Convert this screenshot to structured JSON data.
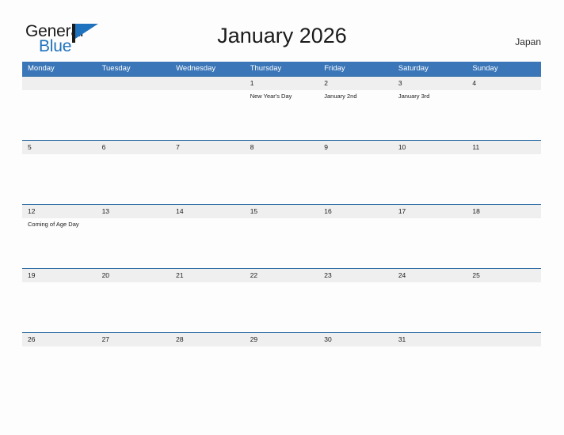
{
  "brand": {
    "name_part1": "General",
    "name_part2": "Blue",
    "mark": "flag-triangle"
  },
  "header": {
    "title": "January 2026",
    "locale": "Japan"
  },
  "colors": {
    "header_blue": "#3a76b8",
    "row_rule_blue": "#2e6da4",
    "date_band_gray": "#efefef",
    "brand_blue": "#1f72bd",
    "page_background": "#fdfdfd",
    "text": "#1b1b1b"
  },
  "calendar": {
    "month": "January",
    "year": "2026",
    "weekdays": [
      "Monday",
      "Tuesday",
      "Wednesday",
      "Thursday",
      "Friday",
      "Saturday",
      "Sunday"
    ],
    "weeks": [
      {
        "days": [
          {
            "date": "",
            "events": []
          },
          {
            "date": "",
            "events": []
          },
          {
            "date": "",
            "events": []
          },
          {
            "date": "1",
            "events": [
              "New Year's Day"
            ]
          },
          {
            "date": "2",
            "events": [
              "January 2nd"
            ]
          },
          {
            "date": "3",
            "events": [
              "January 3rd"
            ]
          },
          {
            "date": "4",
            "events": []
          }
        ]
      },
      {
        "days": [
          {
            "date": "5",
            "events": []
          },
          {
            "date": "6",
            "events": []
          },
          {
            "date": "7",
            "events": []
          },
          {
            "date": "8",
            "events": []
          },
          {
            "date": "9",
            "events": []
          },
          {
            "date": "10",
            "events": []
          },
          {
            "date": "11",
            "events": []
          }
        ]
      },
      {
        "days": [
          {
            "date": "12",
            "events": [
              "Coming of Age Day"
            ]
          },
          {
            "date": "13",
            "events": []
          },
          {
            "date": "14",
            "events": []
          },
          {
            "date": "15",
            "events": []
          },
          {
            "date": "16",
            "events": []
          },
          {
            "date": "17",
            "events": []
          },
          {
            "date": "18",
            "events": []
          }
        ]
      },
      {
        "days": [
          {
            "date": "19",
            "events": []
          },
          {
            "date": "20",
            "events": []
          },
          {
            "date": "21",
            "events": []
          },
          {
            "date": "22",
            "events": []
          },
          {
            "date": "23",
            "events": []
          },
          {
            "date": "24",
            "events": []
          },
          {
            "date": "25",
            "events": []
          }
        ]
      },
      {
        "days": [
          {
            "date": "26",
            "events": []
          },
          {
            "date": "27",
            "events": []
          },
          {
            "date": "28",
            "events": []
          },
          {
            "date": "29",
            "events": []
          },
          {
            "date": "30",
            "events": []
          },
          {
            "date": "31",
            "events": []
          },
          {
            "date": "",
            "events": []
          }
        ]
      }
    ]
  }
}
